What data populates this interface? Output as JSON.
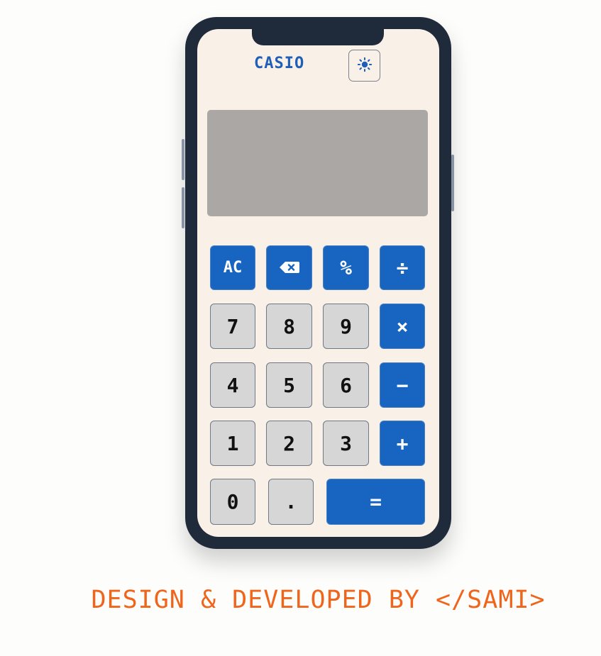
{
  "calculator": {
    "brand": "CASIO",
    "display_value": "",
    "theme_toggle_icon": "sun-icon",
    "colors": {
      "body": "#1f2a3a",
      "screen": "#f9f1e7",
      "display": "#aaa7a4",
      "operator_key": "#1765c0",
      "number_key": "#d6d6d6",
      "brand": "#1f5fb8"
    },
    "keys": {
      "ac": "AC",
      "backspace_icon": "backspace-icon",
      "percent": "%",
      "divide": "÷",
      "seven": "7",
      "eight": "8",
      "nine": "9",
      "multiply": "×",
      "four": "4",
      "five": "5",
      "six": "6",
      "subtract": "−",
      "one": "1",
      "two": "2",
      "three": "3",
      "add": "+",
      "zero": "0",
      "decimal": ".",
      "equals": "="
    }
  },
  "footer": {
    "credit": "DESIGN & DEVELOPED BY </SAMI>",
    "color": "#f0651c"
  }
}
